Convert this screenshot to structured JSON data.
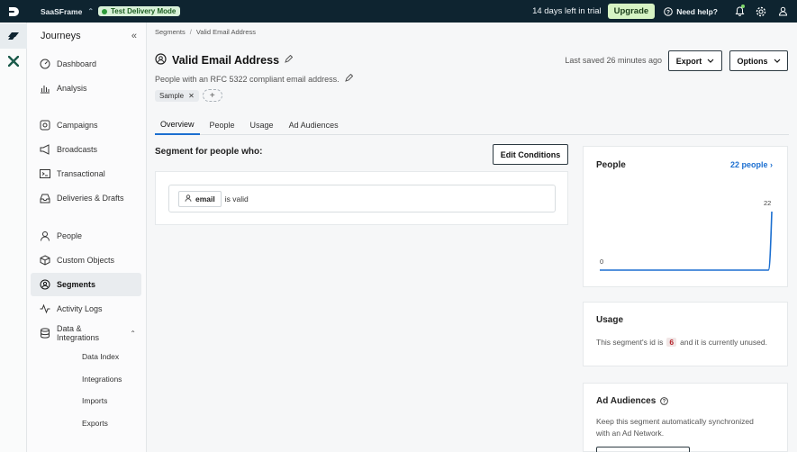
{
  "topbar": {
    "app_name": "SaaSFrame",
    "mode_badge": "Test Delivery Mode",
    "trial_text": "14 days left in trial",
    "upgrade_label": "Upgrade",
    "help_label": "Need help?"
  },
  "sidebar": {
    "title": "Journeys",
    "items": [
      {
        "label": "Dashboard",
        "icon": "speedometer-icon"
      },
      {
        "label": "Analysis",
        "icon": "bar-chart-icon"
      },
      {
        "label": "Campaigns",
        "icon": "campaign-icon"
      },
      {
        "label": "Broadcasts",
        "icon": "megaphone-icon"
      },
      {
        "label": "Transactional",
        "icon": "terminal-icon"
      },
      {
        "label": "Deliveries & Drafts",
        "icon": "inbox-icon"
      },
      {
        "label": "People",
        "icon": "person-icon"
      },
      {
        "label": "Custom Objects",
        "icon": "cube-icon"
      },
      {
        "label": "Segments",
        "icon": "segment-icon"
      },
      {
        "label": "Activity Logs",
        "icon": "activity-icon"
      },
      {
        "label": "Data & Integrations",
        "icon": "database-icon"
      }
    ],
    "subitems": [
      "Data Index",
      "Integrations",
      "Imports",
      "Exports"
    ]
  },
  "breadcrumb": {
    "parent": "Segments",
    "current": "Valid Email Address"
  },
  "segment": {
    "title": "Valid Email Address",
    "description": "People with an RFC 5322 compliant email address.",
    "tag": "Sample",
    "last_saved": "Last saved 26 minutes ago",
    "export_label": "Export",
    "options_label": "Options"
  },
  "tabs": [
    "Overview",
    "People",
    "Usage",
    "Ad Audiences"
  ],
  "conditions": {
    "heading": "Segment for people who:",
    "edit_label": "Edit Conditions",
    "attribute": "email",
    "operator": "is valid"
  },
  "people_panel": {
    "title": "People",
    "count_link": "22 people",
    "chart_data": {
      "type": "line",
      "series": [
        {
          "values": [
            0,
            0,
            0,
            0,
            0,
            0,
            0,
            0,
            0,
            0,
            0,
            0,
            0,
            0,
            0,
            0,
            0,
            0,
            0,
            0,
            0,
            0,
            0,
            0,
            0,
            0,
            0,
            0,
            22
          ]
        }
      ],
      "start_label": "0",
      "end_label": "22",
      "ylim": [
        0,
        22
      ],
      "color": "#1c6fd0"
    }
  },
  "usage_panel": {
    "title": "Usage",
    "text_before": "This segment's id is",
    "id": "6",
    "text_after": "and it is currently unused."
  },
  "ad_panel": {
    "title": "Ad Audiences",
    "text_line1": "Keep this segment automatically synchronized",
    "text_line2": "with an Ad Network."
  }
}
